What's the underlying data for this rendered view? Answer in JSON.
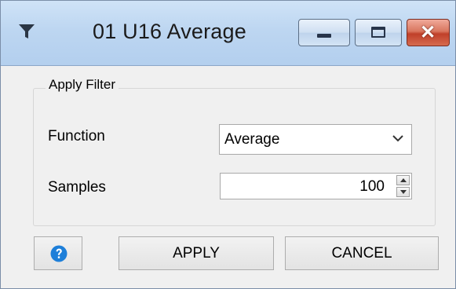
{
  "window": {
    "title": "01 U16 Average",
    "controls": {
      "minimize": "minimize-icon",
      "maximize": "maximize-icon",
      "close": "close-icon",
      "close_color": "#c7452e"
    }
  },
  "group": {
    "label": "Apply Filter"
  },
  "fields": {
    "function_label": "Function",
    "function_value": "Average",
    "samples_label": "Samples",
    "samples_value": "100"
  },
  "buttons": {
    "help_icon": "help-icon",
    "help_color": "#1e7fd9",
    "apply": "APPLY",
    "cancel": "CANCEL"
  }
}
